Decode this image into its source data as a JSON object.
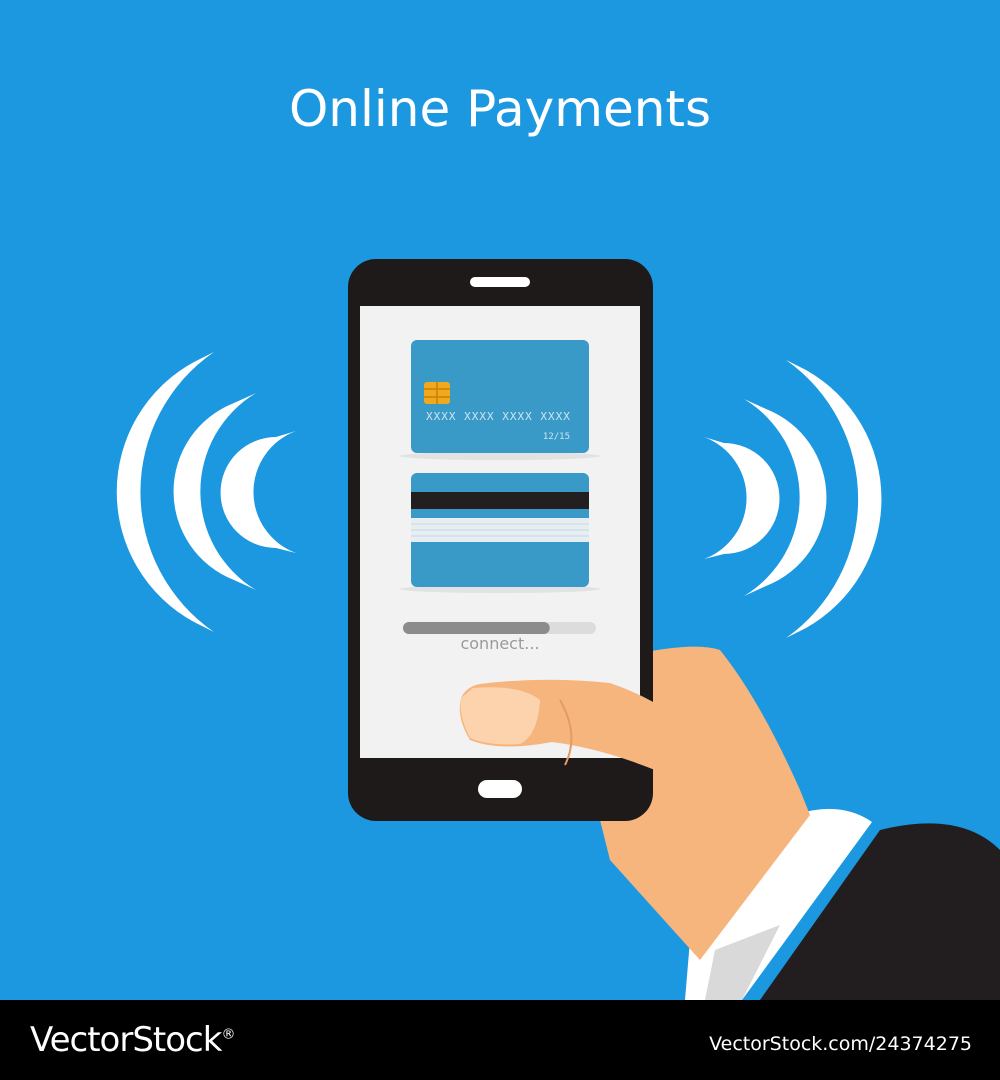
{
  "heading": {
    "title": "Online Payments"
  },
  "card_front": {
    "number": "XXXX XXXX XXXX XXXX",
    "expiry": "12/15"
  },
  "status": {
    "label": "connect...",
    "progress": 0.76
  },
  "footer": {
    "brand": "VectorStock",
    "brand_mark": "®",
    "image_id": "VectorStock.com/24374275"
  },
  "colors": {
    "background": "#1c98e0",
    "phone_body": "#1f1a1a",
    "screen": "#f2f2f2",
    "card": "#3a9ac7",
    "chip": "#f0a81d",
    "skin": "#f7b57e",
    "sleeve": "#221e1f"
  },
  "icons": {
    "wireless_left": "wireless-waves-left-icon",
    "wireless_right": "wireless-waves-right-icon"
  }
}
